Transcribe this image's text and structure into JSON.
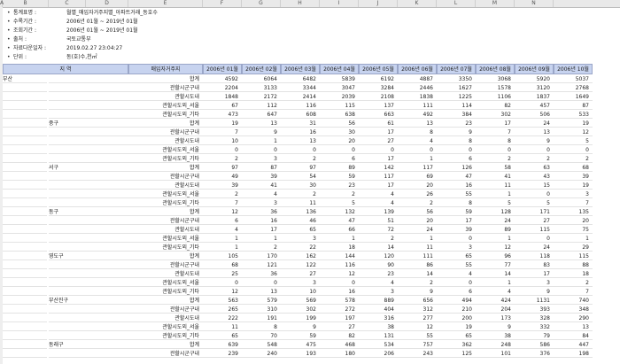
{
  "column_letters": [
    "A",
    "B",
    "C",
    "D",
    "E",
    "F",
    "G",
    "H",
    "I",
    "J",
    "K",
    "L",
    "M",
    "N"
  ],
  "meta": [
    {
      "label": "통계표명 :",
      "value": "월별_매입자거주지별_아파트거래_동호수"
    },
    {
      "label": "수록기간 :",
      "value": "2006년 01월 ~ 2019년 01월"
    },
    {
      "label": "조회기간 :",
      "value": "2006년 01월 ~ 2019년 01월"
    },
    {
      "label": "출처 :",
      "value": "국토교통부"
    },
    {
      "label": "자료다운일자 :",
      "value": "2019.02.27 23:04:27"
    },
    {
      "label": "단위 :",
      "value": "동(호)수,천㎡"
    }
  ],
  "header": {
    "region": "지 역",
    "category": "매입자거주지",
    "months": [
      "2006년 01월",
      "2006년 02월",
      "2006년 03월",
      "2006년 04월",
      "2006년 05월",
      "2006년 06월",
      "2006년 07월",
      "2006년 08월",
      "2006년 09월",
      "2006년 10월"
    ]
  },
  "rows": [
    {
      "r1": "부산",
      "r2": "",
      "cat": "합계",
      "v": [
        "4592",
        "6064",
        "6482",
        "5839",
        "6192",
        "4887",
        "3350",
        "3068",
        "5920",
        "5037"
      ]
    },
    {
      "r1": "",
      "r2": "",
      "cat": "관할시군구내",
      "v": [
        "2204",
        "3133",
        "3344",
        "3047",
        "3284",
        "2446",
        "1627",
        "1578",
        "3120",
        "2768"
      ]
    },
    {
      "r1": "",
      "r2": "",
      "cat": "관할시도내",
      "v": [
        "1848",
        "2172",
        "2414",
        "2039",
        "2108",
        "1838",
        "1225",
        "1106",
        "1837",
        "1649"
      ]
    },
    {
      "r1": "",
      "r2": "",
      "cat": "관할시도외_서울",
      "v": [
        "67",
        "112",
        "116",
        "115",
        "137",
        "111",
        "114",
        "82",
        "457",
        "87"
      ]
    },
    {
      "r1": "",
      "r2": "",
      "cat": "관할시도외_기타",
      "v": [
        "473",
        "647",
        "608",
        "638",
        "663",
        "492",
        "384",
        "302",
        "506",
        "533"
      ]
    },
    {
      "r1": "",
      "r2": "중구",
      "cat": "합계",
      "v": [
        "19",
        "13",
        "31",
        "56",
        "61",
        "13",
        "23",
        "17",
        "24",
        "19"
      ]
    },
    {
      "r1": "",
      "r2": "",
      "cat": "관할시군구내",
      "v": [
        "7",
        "9",
        "16",
        "30",
        "17",
        "8",
        "9",
        "7",
        "13",
        "12"
      ]
    },
    {
      "r1": "",
      "r2": "",
      "cat": "관할시도내",
      "v": [
        "10",
        "1",
        "13",
        "20",
        "27",
        "4",
        "8",
        "8",
        "9",
        "5"
      ]
    },
    {
      "r1": "",
      "r2": "",
      "cat": "관할시도외_서울",
      "v": [
        "0",
        "0",
        "0",
        "0",
        "0",
        "0",
        "0",
        "0",
        "0",
        "0"
      ]
    },
    {
      "r1": "",
      "r2": "",
      "cat": "관할시도외_기타",
      "v": [
        "2",
        "3",
        "2",
        "6",
        "17",
        "1",
        "6",
        "2",
        "2",
        "2"
      ]
    },
    {
      "r1": "",
      "r2": "서구",
      "cat": "합계",
      "v": [
        "97",
        "87",
        "97",
        "89",
        "142",
        "117",
        "126",
        "58",
        "63",
        "68"
      ]
    },
    {
      "r1": "",
      "r2": "",
      "cat": "관할시군구내",
      "v": [
        "49",
        "39",
        "54",
        "59",
        "117",
        "69",
        "47",
        "41",
        "43",
        "39"
      ]
    },
    {
      "r1": "",
      "r2": "",
      "cat": "관할시도내",
      "v": [
        "39",
        "41",
        "30",
        "23",
        "17",
        "20",
        "16",
        "11",
        "15",
        "19"
      ]
    },
    {
      "r1": "",
      "r2": "",
      "cat": "관할시도외_서울",
      "v": [
        "2",
        "4",
        "2",
        "2",
        "4",
        "26",
        "55",
        "1",
        "0",
        "3"
      ]
    },
    {
      "r1": "",
      "r2": "",
      "cat": "관할시도외_기타",
      "v": [
        "7",
        "3",
        "11",
        "5",
        "4",
        "2",
        "8",
        "5",
        "5",
        "7"
      ]
    },
    {
      "r1": "",
      "r2": "동구",
      "cat": "합계",
      "v": [
        "12",
        "36",
        "136",
        "132",
        "139",
        "56",
        "59",
        "128",
        "171",
        "135"
      ]
    },
    {
      "r1": "",
      "r2": "",
      "cat": "관할시군구내",
      "v": [
        "6",
        "16",
        "46",
        "47",
        "51",
        "20",
        "17",
        "24",
        "27",
        "20"
      ]
    },
    {
      "r1": "",
      "r2": "",
      "cat": "관할시도내",
      "v": [
        "4",
        "17",
        "65",
        "66",
        "72",
        "24",
        "39",
        "89",
        "115",
        "75"
      ]
    },
    {
      "r1": "",
      "r2": "",
      "cat": "관할시도외_서울",
      "v": [
        "1",
        "1",
        "3",
        "1",
        "2",
        "1",
        "0",
        "1",
        "0",
        "1"
      ]
    },
    {
      "r1": "",
      "r2": "",
      "cat": "관할시도외_기타",
      "v": [
        "1",
        "2",
        "22",
        "18",
        "14",
        "11",
        "3",
        "12",
        "24",
        "29"
      ]
    },
    {
      "r1": "",
      "r2": "영도구",
      "cat": "합계",
      "v": [
        "105",
        "170",
        "162",
        "144",
        "120",
        "111",
        "65",
        "96",
        "118",
        "115"
      ]
    },
    {
      "r1": "",
      "r2": "",
      "cat": "관할시군구내",
      "v": [
        "68",
        "121",
        "122",
        "116",
        "90",
        "86",
        "55",
        "77",
        "83",
        "88"
      ]
    },
    {
      "r1": "",
      "r2": "",
      "cat": "관할시도내",
      "v": [
        "25",
        "36",
        "27",
        "12",
        "23",
        "14",
        "4",
        "14",
        "17",
        "18"
      ]
    },
    {
      "r1": "",
      "r2": "",
      "cat": "관할시도외_서울",
      "v": [
        "0",
        "0",
        "3",
        "0",
        "4",
        "2",
        "0",
        "1",
        "3",
        "2"
      ]
    },
    {
      "r1": "",
      "r2": "",
      "cat": "관할시도외_기타",
      "v": [
        "12",
        "13",
        "10",
        "16",
        "3",
        "9",
        "6",
        "4",
        "9",
        "7"
      ]
    },
    {
      "r1": "",
      "r2": "부산진구",
      "cat": "합계",
      "v": [
        "563",
        "579",
        "569",
        "578",
        "889",
        "656",
        "494",
        "424",
        "1131",
        "740"
      ]
    },
    {
      "r1": "",
      "r2": "",
      "cat": "관할시군구내",
      "v": [
        "265",
        "310",
        "302",
        "272",
        "404",
        "312",
        "210",
        "204",
        "393",
        "348"
      ]
    },
    {
      "r1": "",
      "r2": "",
      "cat": "관할시도내",
      "v": [
        "222",
        "191",
        "199",
        "197",
        "316",
        "277",
        "200",
        "173",
        "328",
        "290"
      ]
    },
    {
      "r1": "",
      "r2": "",
      "cat": "관할시도외_서울",
      "v": [
        "11",
        "8",
        "9",
        "27",
        "38",
        "12",
        "19",
        "9",
        "332",
        "13"
      ]
    },
    {
      "r1": "",
      "r2": "",
      "cat": "관할시도외_기타",
      "v": [
        "65",
        "70",
        "59",
        "82",
        "131",
        "55",
        "65",
        "38",
        "79",
        "84"
      ]
    },
    {
      "r1": "",
      "r2": "동래구",
      "cat": "합계",
      "v": [
        "639",
        "548",
        "475",
        "468",
        "534",
        "757",
        "362",
        "248",
        "586",
        "447"
      ]
    },
    {
      "r1": "",
      "r2": "",
      "cat": "관할시군구내",
      "v": [
        "239",
        "240",
        "193",
        "180",
        "206",
        "243",
        "125",
        "101",
        "376",
        "198"
      ]
    }
  ]
}
